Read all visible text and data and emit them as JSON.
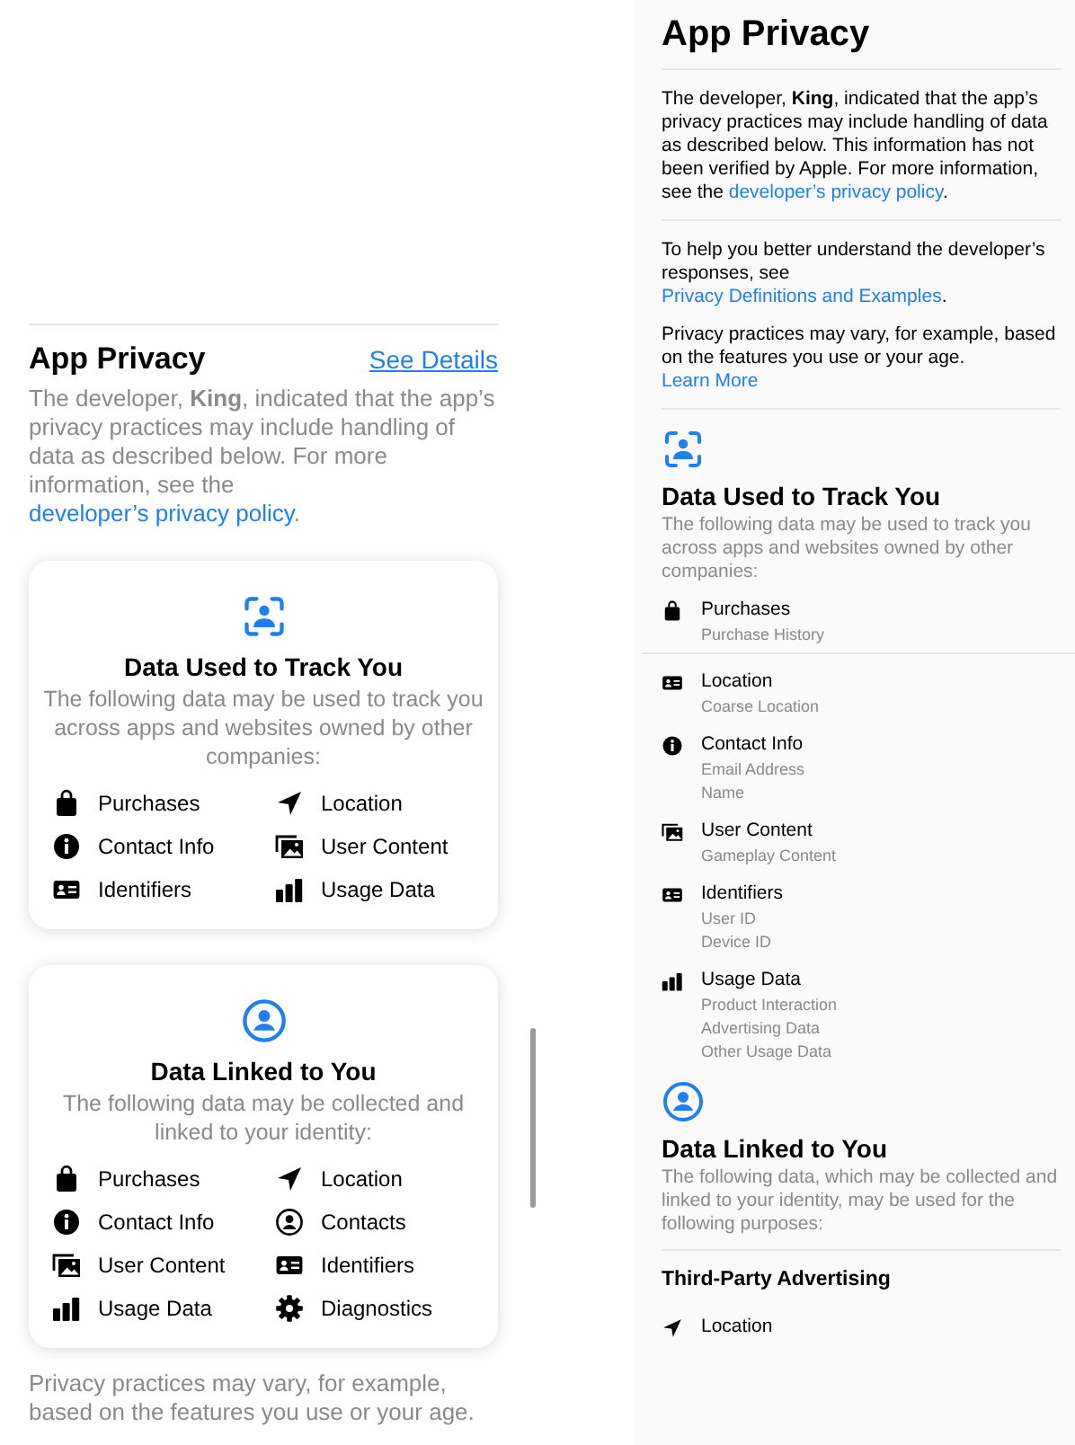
{
  "summary": {
    "title": "App Privacy",
    "see_details": "See Details",
    "intro": "The developer, **King**, indicated that the app’s privacy practices may include handling of data as described below. For more information, see the ",
    "intro_link": "developer’s privacy policy",
    "intro_end": ".",
    "cards": [
      {
        "kind": "track",
        "title": "Data Used to Track You",
        "description": "The following data may be used to track you across apps and websites owned by other companies:",
        "items": [
          {
            "label": "Purchases",
            "kind": "bag"
          },
          {
            "label": "Location",
            "kind": "location"
          },
          {
            "label": "Contact Info",
            "kind": "info"
          },
          {
            "label": "User Content",
            "kind": "photos"
          },
          {
            "label": "Identifiers",
            "kind": "idcard"
          },
          {
            "label": "Usage Data",
            "kind": "bars"
          }
        ]
      },
      {
        "kind": "linked",
        "title": "Data Linked to You",
        "description": "The following data may be collected and linked to your identity:",
        "items": [
          {
            "label": "Purchases",
            "kind": "bag"
          },
          {
            "label": "Location",
            "kind": "location"
          },
          {
            "label": "Contact Info",
            "kind": "info"
          },
          {
            "label": "Contacts",
            "kind": "person"
          },
          {
            "label": "User Content",
            "kind": "photos"
          },
          {
            "label": "Identifiers",
            "kind": "idcard"
          },
          {
            "label": "Usage Data",
            "kind": "bars"
          },
          {
            "label": "Diagnostics",
            "kind": "gear"
          }
        ]
      }
    ],
    "footer": "Privacy practices may vary, for example, based on the features you use or your age."
  },
  "details": {
    "title": "App Privacy",
    "intro": "The developer, **King**, indicated that the app’s privacy practices may include handling of data as described below. This information has not been verified by Apple. For more information, see the ",
    "intro_link": "developer’s privacy policy",
    "intro_end": ".",
    "help": "To help you better understand the developer’s responses, see ",
    "help_link": "Privacy Definitions and Examples",
    "help_end": ".",
    "vary": "Privacy practices may vary, for example, based on the features you use or your age.",
    "learn_more": "Learn More",
    "track": {
      "kind": "track",
      "title": "Data Used to Track You",
      "description": "The following data may be used to track you across apps and websites owned by other companies:",
      "items": [
        {
          "label": "Purchases",
          "kind": "bag",
          "details": [
            "Purchase History"
          ]
        },
        {
          "label": "Location",
          "kind": "idcard",
          "details": [
            "Coarse Location"
          ]
        },
        {
          "label": "Contact Info",
          "kind": "info",
          "details": [
            "Email Address",
            "Name"
          ]
        },
        {
          "label": "User Content",
          "kind": "photos",
          "details": [
            "Gameplay Content"
          ]
        },
        {
          "label": "Identifiers",
          "kind": "idcard",
          "details": [
            "User ID",
            "Device ID"
          ]
        },
        {
          "label": "Usage Data",
          "kind": "bars",
          "details": [
            "Product Interaction",
            "Advertising Data",
            "Other Usage Data"
          ]
        }
      ]
    },
    "linked": {
      "kind": "linked",
      "title": "Data Linked to You",
      "description": "The following data, which may be collected and linked to your identity, may be used for the following purposes:",
      "purpose": "Third-Party Advertising",
      "items": [
        {
          "label": "Location",
          "kind": "location"
        }
      ]
    }
  }
}
